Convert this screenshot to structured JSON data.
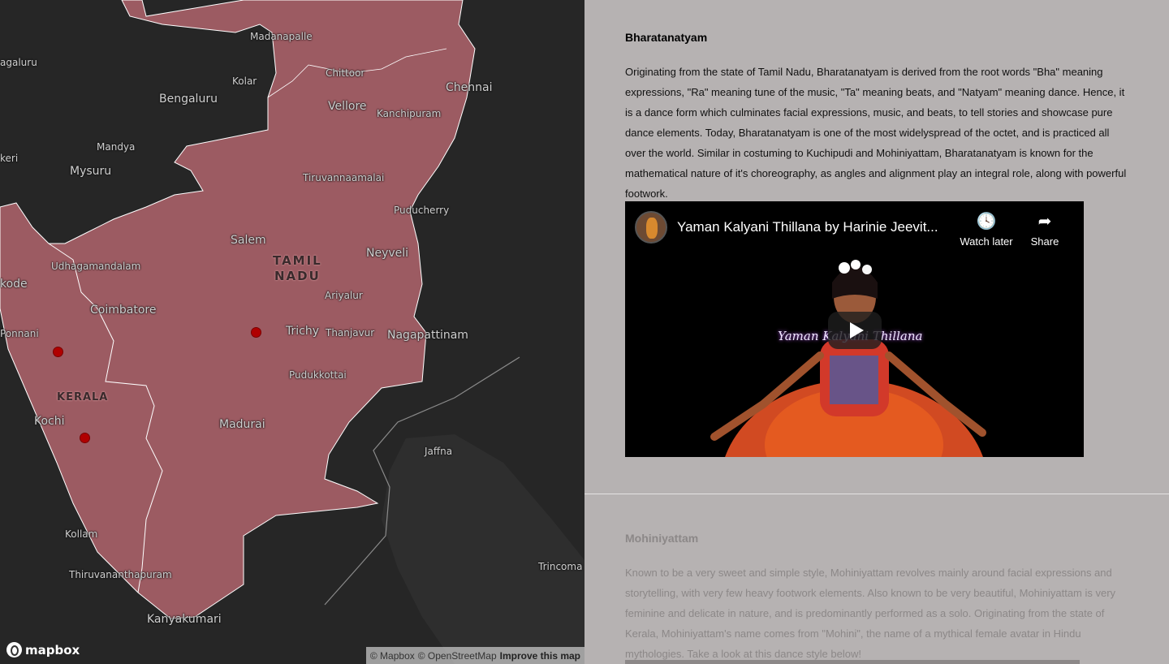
{
  "map": {
    "cities": [
      {
        "label": "Madanapalle",
        "kind": "town"
      },
      {
        "label": "Chittoor",
        "kind": "town"
      },
      {
        "label": "Chennai",
        "kind": "city"
      },
      {
        "label": "Kolar",
        "kind": "town"
      },
      {
        "label": "Bengaluru",
        "kind": "city"
      },
      {
        "label": "Vellore",
        "kind": "city"
      },
      {
        "label": "Kanchipuram",
        "kind": "town"
      },
      {
        "label": "agaluru",
        "kind": "town"
      },
      {
        "label": "Mandya",
        "kind": "town"
      },
      {
        "label": "Mysuru",
        "kind": "city"
      },
      {
        "label": "keri",
        "kind": "town"
      },
      {
        "label": "Tiruvannaamalai",
        "kind": "town"
      },
      {
        "label": "Puducherry",
        "kind": "town"
      },
      {
        "label": "Salem",
        "kind": "city"
      },
      {
        "label": "Udhagamandalam",
        "kind": "town"
      },
      {
        "label": "Neyveli",
        "kind": "city"
      },
      {
        "label": "kode",
        "kind": "city"
      },
      {
        "label": "Ariyalur",
        "kind": "town"
      },
      {
        "label": "Coimbatore",
        "kind": "city"
      },
      {
        "label": "Ponnani",
        "kind": "town"
      },
      {
        "label": "Trichy",
        "kind": "city"
      },
      {
        "label": "Thanjavur",
        "kind": "town"
      },
      {
        "label": "Nagapattinam",
        "kind": "city"
      },
      {
        "label": "Pudukkottai",
        "kind": "town"
      },
      {
        "label": "Kochi",
        "kind": "city"
      },
      {
        "label": "Madurai",
        "kind": "city"
      },
      {
        "label": "Jaffna",
        "kind": "town"
      },
      {
        "label": "Kollam",
        "kind": "town"
      },
      {
        "label": "Trincoma",
        "kind": "town"
      },
      {
        "label": "Thiruvananthapuram",
        "kind": "town"
      },
      {
        "label": "Kanyakumari",
        "kind": "city"
      }
    ],
    "states": {
      "tamil_nadu": "TAMIL\nNADU",
      "kerala": "KERALA"
    },
    "colors": {
      "highlight_fill": "#9c5b62",
      "land": "#262626",
      "marker": "#b00000"
    },
    "logo_text": "mapbox",
    "attribution": {
      "mapbox": "© Mapbox",
      "osm": "© OpenStreetMap",
      "improve": "Improve this map"
    }
  },
  "story": {
    "sections": [
      {
        "title": "Bharatanatyam",
        "body": "Originating from the state of Tamil Nadu, Bharatanatyam is derived from the root words \"Bha\" meaning expressions, \"Ra\" meaning tune of the music, \"Ta\" meaning beats, and \"Natyam\" meaning dance. Hence, it is a dance form which culminates facial expressions, music, and beats, to tell stories and showcase pure dance elements. Today, Bharatanatyam is one of the most widelyspread of the octet, and is practiced all over the world. Similar in costuming to Kuchipudi and Mohiniyattam, Bharatanatyam is known for the mathematical nature of it's choreography, as angles and alignment play an integral role, along with powerful footwork."
      },
      {
        "title": "Mohiniyattam",
        "body": "Known to be a very sweet and simple style, Mohiniyattam revolves mainly around facial expressions and storytelling, with very few heavy footwork elements. Also known to be very beautiful, Mohiniyattam is very feminine and delicate in nature, and is predominantly performed as a solo. Originating from the state of Kerala, Mohiniyattam's name comes from \"Mohini\", the name of a mythical female avatar in Hindu mythologies. Take a look at this dance style below!"
      }
    ],
    "video": {
      "title": "Yaman Kalyani Thillana by Harinie Jeevit...",
      "watch_later": "Watch later",
      "share": "Share",
      "overlay_text": "Yaman Kalyani Thillana",
      "watch_later_icon": "clock-icon",
      "share_icon": "share-arrow-icon"
    }
  }
}
